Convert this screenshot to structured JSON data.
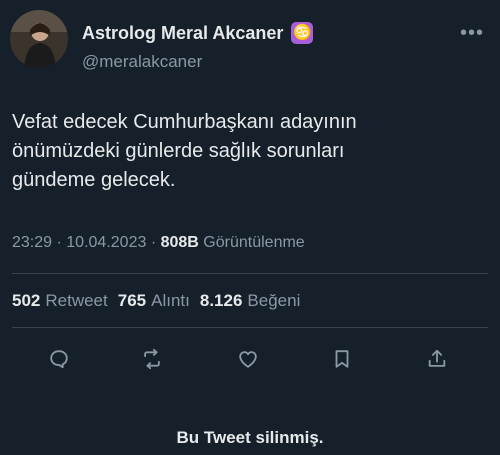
{
  "author": {
    "display_name": "Astrolog Meral Akcaner",
    "badge": "♋",
    "handle": "@meralakcaner"
  },
  "tweet": {
    "text": "Vefat edecek Cumhurbaşkanı adayının\nönümüzdeki günlerde sağlık sorunları\ngündeme gelecek.",
    "time": "23:29",
    "date": "10.04.2023",
    "views_count": "808B",
    "views_label": "Görüntülenme"
  },
  "stats": {
    "retweets_count": "502",
    "retweets_label": "Retweet",
    "quotes_count": "765",
    "quotes_label": "Alıntı",
    "likes_count": "8.126",
    "likes_label": "Beğeni"
  },
  "actions": {
    "icons": [
      "reply-icon",
      "retweet-icon",
      "like-icon",
      "bookmark-icon",
      "share-icon"
    ]
  },
  "footer": {
    "deleted_notice": "Bu Tweet silinmiş."
  },
  "colors": {
    "background": "#15202b",
    "text": "#e7e9ea",
    "secondary": "#8b98a5",
    "badge": "#a65ed9"
  }
}
